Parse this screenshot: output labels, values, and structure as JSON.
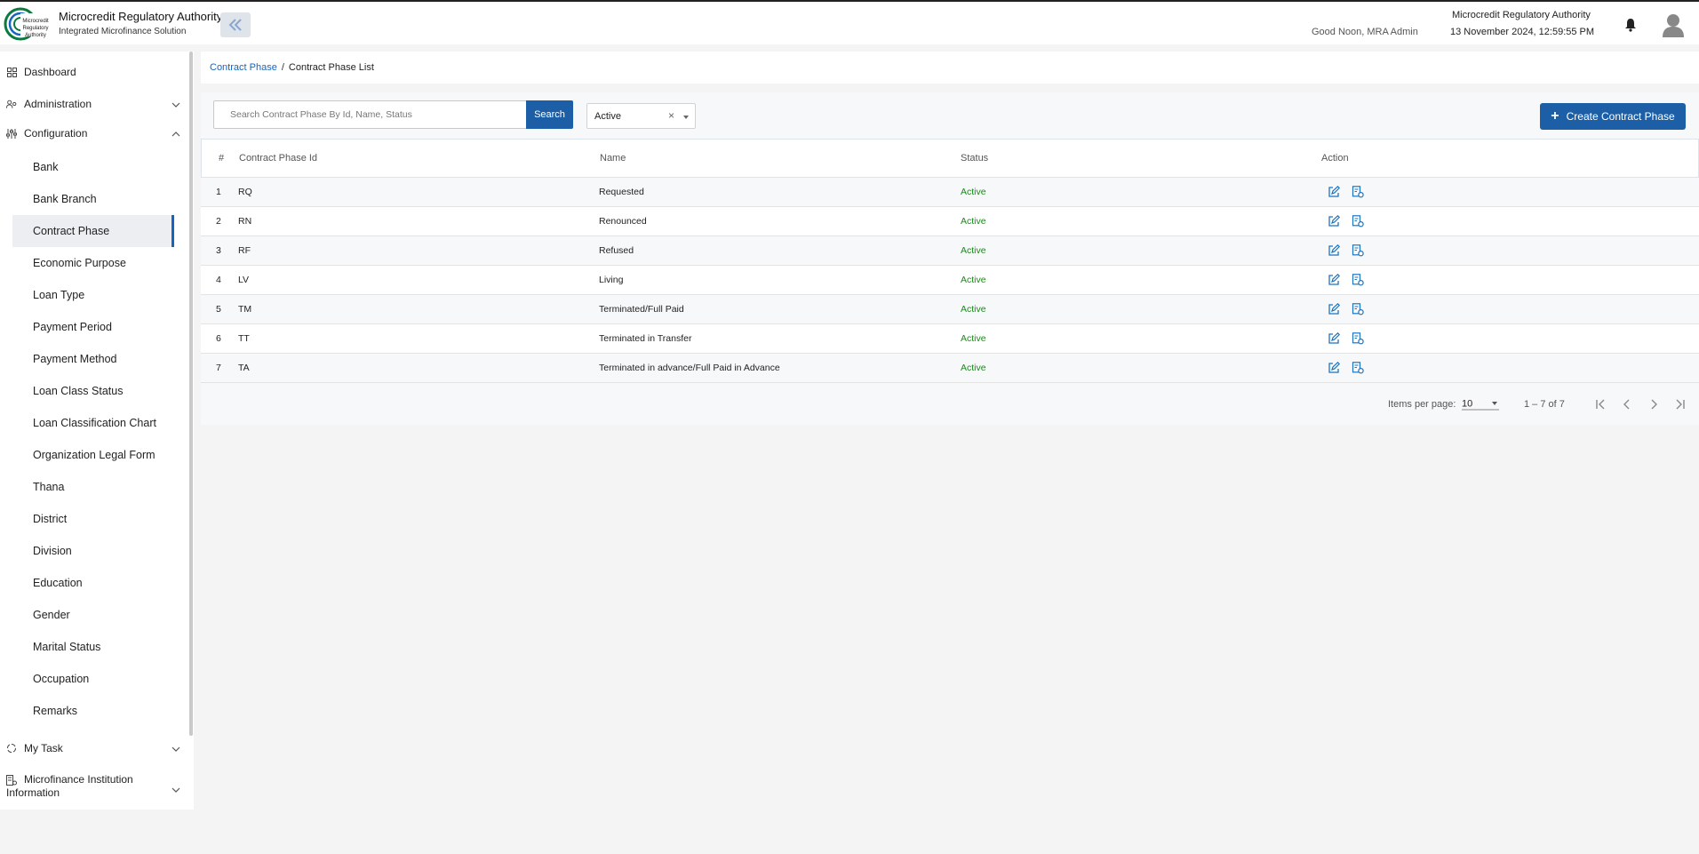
{
  "header": {
    "org_name": "Microcredit Regulatory Authority",
    "org_subtitle": "Integrated Microfinance Solution",
    "logo_text": "Microcredit Regulatory Authority",
    "greeting": "Good Noon, MRA Admin",
    "right_org_name": "Microcredit Regulatory Authority",
    "datetime": "13 November 2024, 12:59:55 PM",
    "icons": [
      "double-chevron-left-icon",
      "bell-icon",
      "user-avatar-icon"
    ]
  },
  "sidebar": {
    "dashboard": "Dashboard",
    "administration": "Administration",
    "configuration": "Configuration",
    "config_items": [
      "Bank",
      "Bank Branch",
      "Contract Phase",
      "Economic Purpose",
      "Loan Type",
      "Payment Period",
      "Payment Method",
      "Loan Class Status",
      "Loan Classification Chart",
      "Organization Legal Form",
      "Thana",
      "District",
      "Division",
      "Education",
      "Gender",
      "Marital Status",
      "Occupation",
      "Remarks"
    ],
    "active_item": "Contract Phase",
    "my_task": "My Task",
    "mfi_line1": "Microfinance Institution",
    "mfi_line2": "Information"
  },
  "breadcrumb": {
    "parent": "Contract Phase",
    "separator": "/",
    "current": "Contract Phase List"
  },
  "toolbar": {
    "search_placeholder": "Search Contract Phase By Id, Name, Status",
    "search_button": "Search",
    "status_filter": "Active",
    "clear_symbol": "×",
    "create_button": "Create Contract Phase",
    "create_icon": "+"
  },
  "table": {
    "columns": [
      "#",
      "Contract Phase Id",
      "Name",
      "Status",
      "Action"
    ],
    "rows": [
      {
        "no": "1",
        "id": "RQ",
        "name": "Requested",
        "status": "Active"
      },
      {
        "no": "2",
        "id": "RN",
        "name": "Renounced",
        "status": "Active"
      },
      {
        "no": "3",
        "id": "RF",
        "name": "Refused",
        "status": "Active"
      },
      {
        "no": "4",
        "id": "LV",
        "name": "Living",
        "status": "Active"
      },
      {
        "no": "5",
        "id": "TM",
        "name": "Terminated/Full Paid",
        "status": "Active"
      },
      {
        "no": "6",
        "id": "TT",
        "name": "Terminated in Transfer",
        "status": "Active"
      },
      {
        "no": "7",
        "id": "TA",
        "name": "Terminated in advance/Full Paid in Advance",
        "status": "Active"
      }
    ],
    "row_action_icons": [
      "edit-icon",
      "view-details-icon"
    ]
  },
  "pager": {
    "items_label": "Items per page:",
    "page_size": "10",
    "range": "1 – 7 of 7"
  },
  "colors": {
    "primary": "#1d5fa6",
    "link": "#1565c0",
    "status_active": "#1a8a1a",
    "background": "#f4f4f4"
  }
}
